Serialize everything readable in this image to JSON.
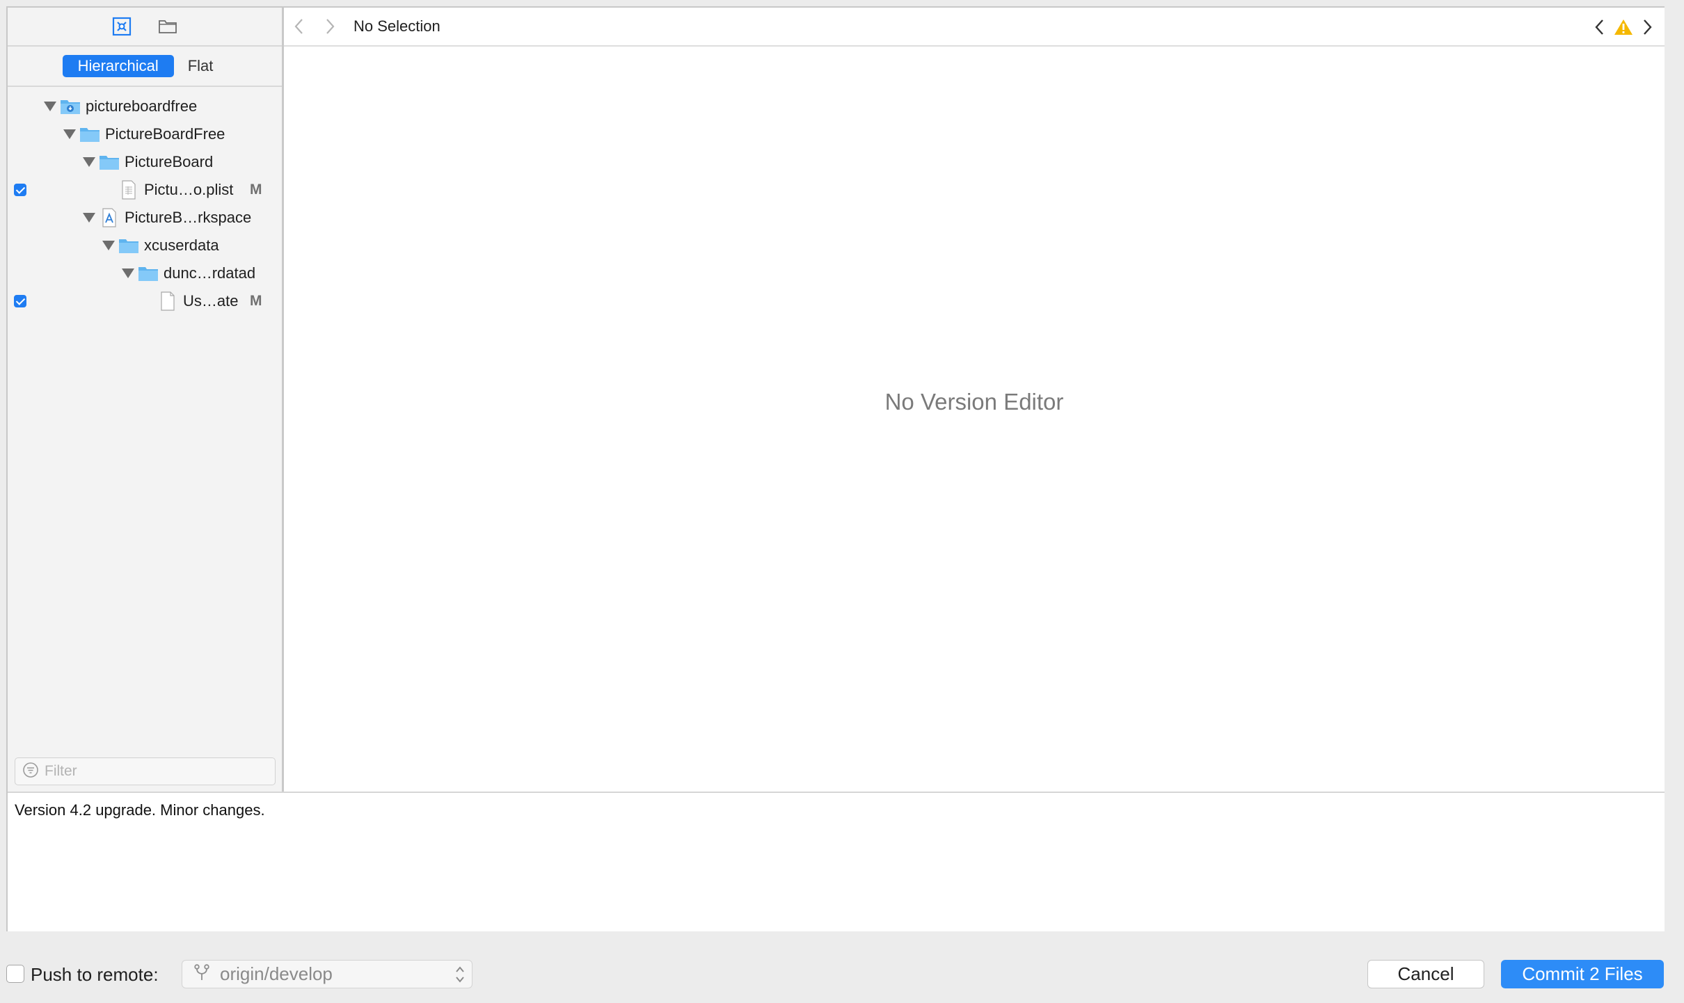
{
  "window": {
    "editor_placeholder": "No Version Editor",
    "jumpbar": {
      "title": "No Selection"
    }
  },
  "sidebar": {
    "view_modes": [
      "Hierarchical",
      "Flat"
    ],
    "selected_view_mode": "Hierarchical",
    "filter_placeholder": "Filter",
    "tree": [
      {
        "label": "pictureboardfree",
        "depth": 0,
        "icon": "project-folder-icon",
        "expanded": true,
        "checkbox": null,
        "badge": ""
      },
      {
        "label": "PictureBoardFree",
        "depth": 1,
        "icon": "folder-icon",
        "expanded": true,
        "checkbox": null,
        "badge": ""
      },
      {
        "label": "PictureBoard",
        "depth": 2,
        "icon": "folder-icon",
        "expanded": true,
        "checkbox": null,
        "badge": ""
      },
      {
        "label": "Pictu…o.plist",
        "depth": 3,
        "icon": "plist-file-icon",
        "expanded": null,
        "checkbox": true,
        "badge": "M"
      },
      {
        "label": "PictureB…rkspace",
        "depth": 2,
        "icon": "workspace-icon",
        "expanded": true,
        "checkbox": null,
        "badge": ""
      },
      {
        "label": "xcuserdata",
        "depth": 3,
        "icon": "folder-icon",
        "expanded": true,
        "checkbox": null,
        "badge": ""
      },
      {
        "label": "dunc…rdatad",
        "depth": 4,
        "icon": "folder-icon",
        "expanded": true,
        "checkbox": null,
        "badge": ""
      },
      {
        "label": "Us…ate",
        "depth": 5,
        "icon": "file-icon",
        "expanded": null,
        "checkbox": true,
        "badge": "M"
      }
    ]
  },
  "commit_message": "Version 4.2 upgrade. Minor changes.",
  "bottombar": {
    "push_label": "Push to remote:",
    "push_checked": false,
    "branch": "origin/develop",
    "cancel_label": "Cancel",
    "commit_label": "Commit 2 Files"
  },
  "colors": {
    "accent": "#1e7cf2",
    "folder": "#7cc6f7",
    "warning": "#f5b800"
  }
}
